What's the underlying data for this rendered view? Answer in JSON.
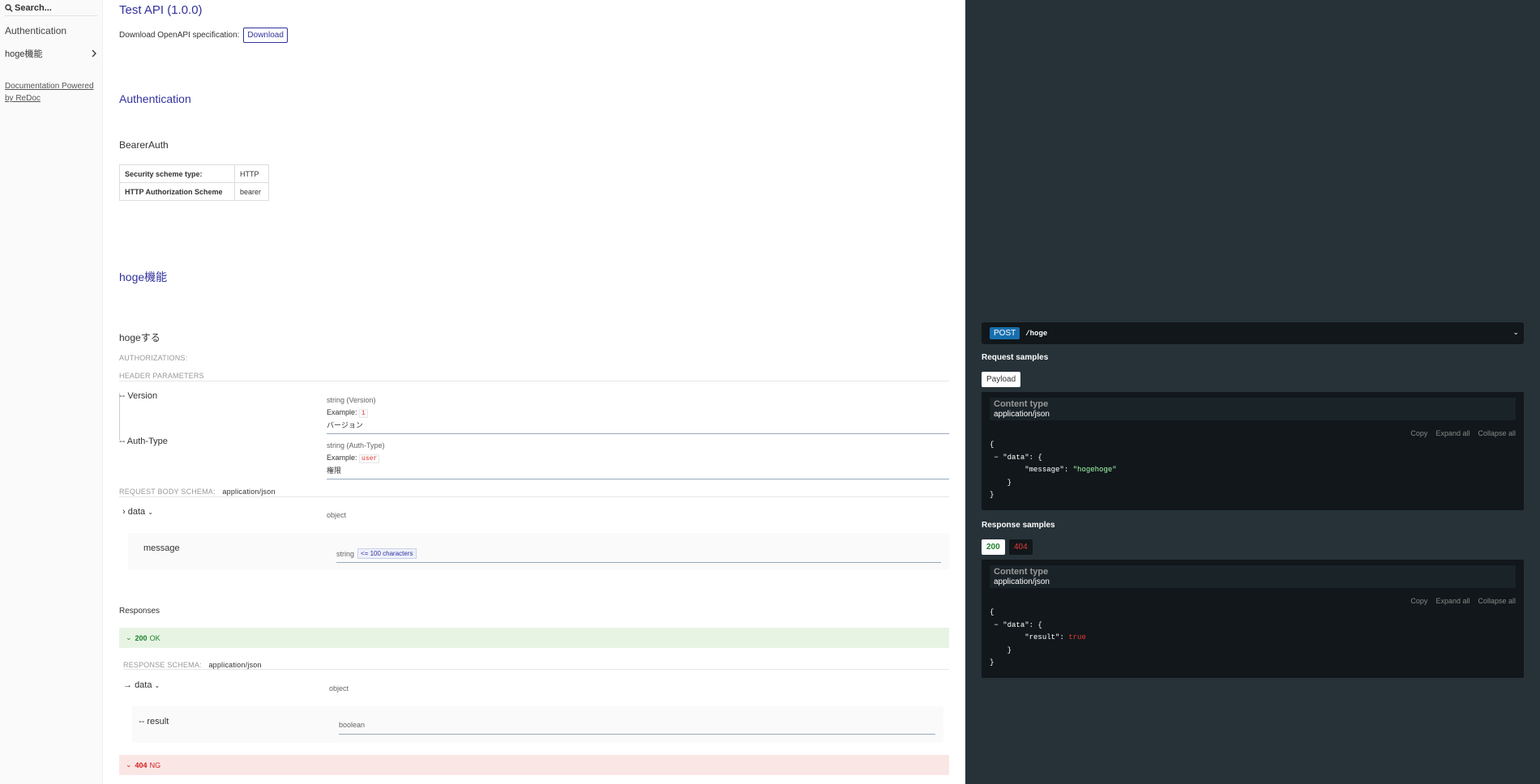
{
  "sidebar": {
    "search_placeholder": "Search...",
    "items": [
      {
        "label": "Authentication"
      },
      {
        "label": "hoge機能"
      }
    ],
    "powered_by": "Documentation Powered by ReDoc"
  },
  "main": {
    "api_title": "Test API (1.0.0)",
    "download_label": "Download OpenAPI specification:",
    "download_button": "Download",
    "auth_heading": "Authentication",
    "scheme_name": "BearerAuth",
    "scheme_table": [
      {
        "key": "Security scheme type:",
        "value": "HTTP"
      },
      {
        "key": "HTTP Authorization Scheme",
        "value": "bearer"
      }
    ],
    "tag_heading": "hoge機能",
    "operation_title": "hogeする",
    "authorizations_label": "AUTHORIZATIONS:",
    "header_params_label": "HEADER PARAMETERS",
    "params": [
      {
        "name": "Version",
        "type": "string (Version)",
        "example_label": "Example:",
        "example": "1",
        "description": "バージョン"
      },
      {
        "name": "Auth-Type",
        "type": "string (Auth-Type)",
        "example_label": "Example:",
        "example": "user",
        "description": "権限"
      }
    ],
    "request_body_label": "REQUEST BODY SCHEMA:",
    "request_body_type": "application/json",
    "body_field": {
      "name": "data",
      "type": "object"
    },
    "body_subfield": {
      "name": "message",
      "type": "string",
      "constraint": "<= 100 characters"
    },
    "responses_heading": "Responses",
    "response_200": {
      "code": "200",
      "text": "OK"
    },
    "response_schema_label": "RESPONSE SCHEMA:",
    "response_schema_type": "application/json",
    "response_field": {
      "name": "data",
      "type": "object"
    },
    "response_subfield": {
      "name": "result",
      "type": "boolean"
    },
    "response_404": {
      "code": "404",
      "text": "NG"
    }
  },
  "right": {
    "method": "POST",
    "path": "/hoge",
    "request_samples": "Request samples",
    "payload_tab": "Payload",
    "content_type_label": "Content type",
    "content_type": "application/json",
    "copy": "Copy",
    "expand_all": "Expand all",
    "collapse_all": "Collapse all",
    "request_code": {
      "key": "\"data\"",
      "inner_key": "\"message\"",
      "inner_value": "\"hogehoge\""
    },
    "response_samples": "Response samples",
    "tab_200": "200",
    "tab_404": "404",
    "response_code": {
      "key": "\"data\"",
      "inner_key": "\"result\"",
      "inner_value": "true"
    }
  },
  "colors": {
    "accent": "#32329f",
    "right_bg": "#263238",
    "ok": "#1d8127",
    "ng": "#d41f1c",
    "post": "#186fad"
  }
}
